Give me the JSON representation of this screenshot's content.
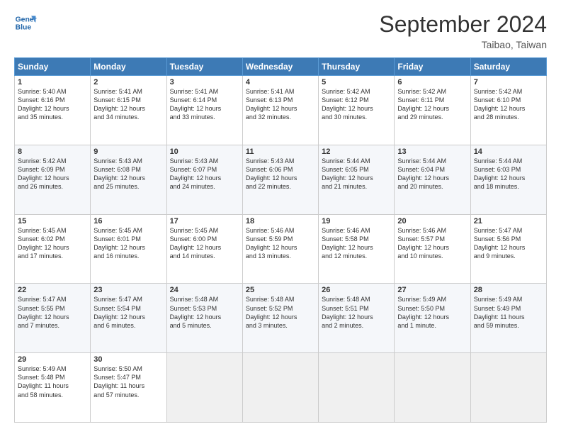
{
  "header": {
    "logo_line1": "General",
    "logo_line2": "Blue",
    "month": "September 2024",
    "location": "Taibao, Taiwan"
  },
  "weekdays": [
    "Sunday",
    "Monday",
    "Tuesday",
    "Wednesday",
    "Thursday",
    "Friday",
    "Saturday"
  ],
  "weeks": [
    [
      {
        "day": "1",
        "info": "Sunrise: 5:40 AM\nSunset: 6:16 PM\nDaylight: 12 hours\nand 35 minutes."
      },
      {
        "day": "2",
        "info": "Sunrise: 5:41 AM\nSunset: 6:15 PM\nDaylight: 12 hours\nand 34 minutes."
      },
      {
        "day": "3",
        "info": "Sunrise: 5:41 AM\nSunset: 6:14 PM\nDaylight: 12 hours\nand 33 minutes."
      },
      {
        "day": "4",
        "info": "Sunrise: 5:41 AM\nSunset: 6:13 PM\nDaylight: 12 hours\nand 32 minutes."
      },
      {
        "day": "5",
        "info": "Sunrise: 5:42 AM\nSunset: 6:12 PM\nDaylight: 12 hours\nand 30 minutes."
      },
      {
        "day": "6",
        "info": "Sunrise: 5:42 AM\nSunset: 6:11 PM\nDaylight: 12 hours\nand 29 minutes."
      },
      {
        "day": "7",
        "info": "Sunrise: 5:42 AM\nSunset: 6:10 PM\nDaylight: 12 hours\nand 28 minutes."
      }
    ],
    [
      {
        "day": "8",
        "info": "Sunrise: 5:42 AM\nSunset: 6:09 PM\nDaylight: 12 hours\nand 26 minutes."
      },
      {
        "day": "9",
        "info": "Sunrise: 5:43 AM\nSunset: 6:08 PM\nDaylight: 12 hours\nand 25 minutes."
      },
      {
        "day": "10",
        "info": "Sunrise: 5:43 AM\nSunset: 6:07 PM\nDaylight: 12 hours\nand 24 minutes."
      },
      {
        "day": "11",
        "info": "Sunrise: 5:43 AM\nSunset: 6:06 PM\nDaylight: 12 hours\nand 22 minutes."
      },
      {
        "day": "12",
        "info": "Sunrise: 5:44 AM\nSunset: 6:05 PM\nDaylight: 12 hours\nand 21 minutes."
      },
      {
        "day": "13",
        "info": "Sunrise: 5:44 AM\nSunset: 6:04 PM\nDaylight: 12 hours\nand 20 minutes."
      },
      {
        "day": "14",
        "info": "Sunrise: 5:44 AM\nSunset: 6:03 PM\nDaylight: 12 hours\nand 18 minutes."
      }
    ],
    [
      {
        "day": "15",
        "info": "Sunrise: 5:45 AM\nSunset: 6:02 PM\nDaylight: 12 hours\nand 17 minutes."
      },
      {
        "day": "16",
        "info": "Sunrise: 5:45 AM\nSunset: 6:01 PM\nDaylight: 12 hours\nand 16 minutes."
      },
      {
        "day": "17",
        "info": "Sunrise: 5:45 AM\nSunset: 6:00 PM\nDaylight: 12 hours\nand 14 minutes."
      },
      {
        "day": "18",
        "info": "Sunrise: 5:46 AM\nSunset: 5:59 PM\nDaylight: 12 hours\nand 13 minutes."
      },
      {
        "day": "19",
        "info": "Sunrise: 5:46 AM\nSunset: 5:58 PM\nDaylight: 12 hours\nand 12 minutes."
      },
      {
        "day": "20",
        "info": "Sunrise: 5:46 AM\nSunset: 5:57 PM\nDaylight: 12 hours\nand 10 minutes."
      },
      {
        "day": "21",
        "info": "Sunrise: 5:47 AM\nSunset: 5:56 PM\nDaylight: 12 hours\nand 9 minutes."
      }
    ],
    [
      {
        "day": "22",
        "info": "Sunrise: 5:47 AM\nSunset: 5:55 PM\nDaylight: 12 hours\nand 7 minutes."
      },
      {
        "day": "23",
        "info": "Sunrise: 5:47 AM\nSunset: 5:54 PM\nDaylight: 12 hours\nand 6 minutes."
      },
      {
        "day": "24",
        "info": "Sunrise: 5:48 AM\nSunset: 5:53 PM\nDaylight: 12 hours\nand 5 minutes."
      },
      {
        "day": "25",
        "info": "Sunrise: 5:48 AM\nSunset: 5:52 PM\nDaylight: 12 hours\nand 3 minutes."
      },
      {
        "day": "26",
        "info": "Sunrise: 5:48 AM\nSunset: 5:51 PM\nDaylight: 12 hours\nand 2 minutes."
      },
      {
        "day": "27",
        "info": "Sunrise: 5:49 AM\nSunset: 5:50 PM\nDaylight: 12 hours\nand 1 minute."
      },
      {
        "day": "28",
        "info": "Sunrise: 5:49 AM\nSunset: 5:49 PM\nDaylight: 11 hours\nand 59 minutes."
      }
    ],
    [
      {
        "day": "29",
        "info": "Sunrise: 5:49 AM\nSunset: 5:48 PM\nDaylight: 11 hours\nand 58 minutes."
      },
      {
        "day": "30",
        "info": "Sunrise: 5:50 AM\nSunset: 5:47 PM\nDaylight: 11 hours\nand 57 minutes."
      },
      null,
      null,
      null,
      null,
      null
    ]
  ]
}
